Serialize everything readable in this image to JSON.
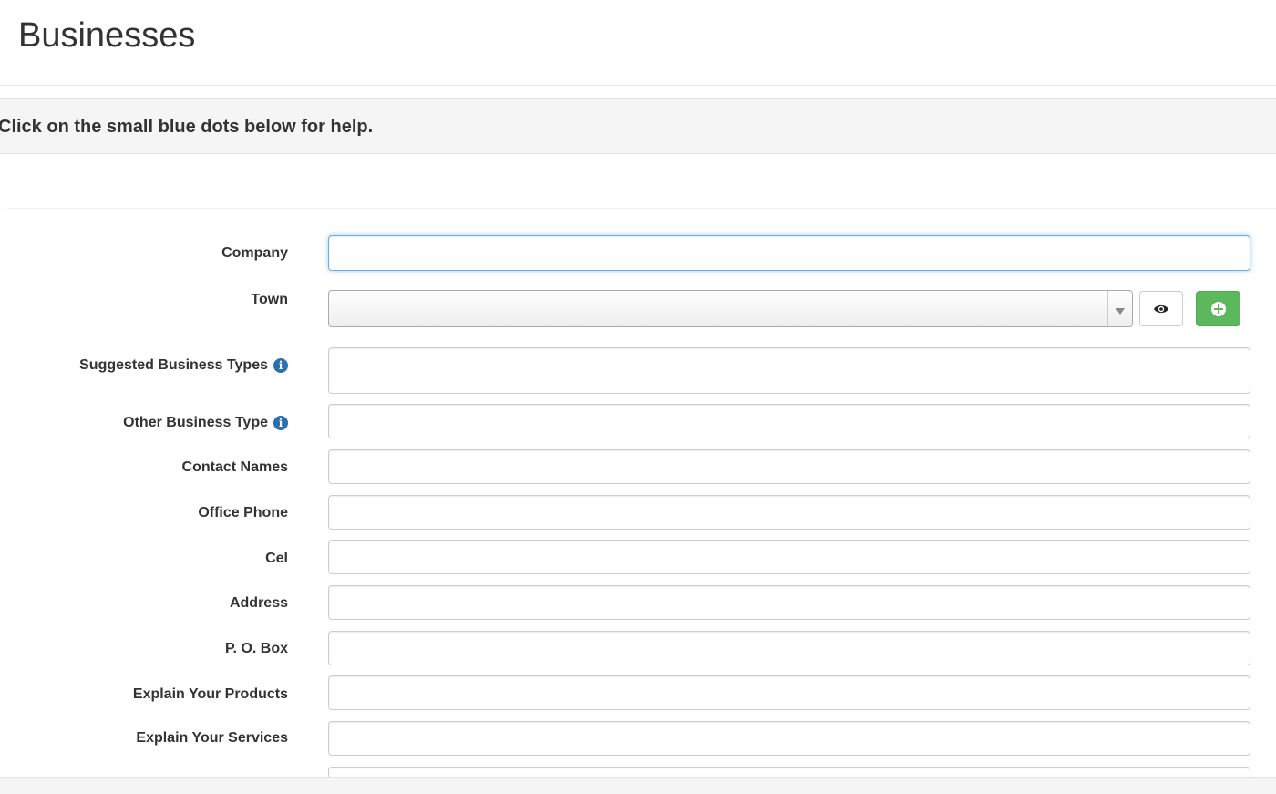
{
  "header": {
    "title": "Businesses"
  },
  "help": {
    "text": "Click on the small blue dots below for help."
  },
  "form": {
    "company": {
      "label": "Company",
      "value": ""
    },
    "town": {
      "label": "Town",
      "selected": ""
    },
    "suggested_business_types": {
      "label": "Suggested Business Types",
      "value": ""
    },
    "other_business_type": {
      "label": "Other Business Type",
      "value": ""
    },
    "contact_names": {
      "label": "Contact Names",
      "value": ""
    },
    "office_phone": {
      "label": "Office Phone",
      "value": ""
    },
    "cel": {
      "label": "Cel",
      "value": ""
    },
    "address": {
      "label": "Address",
      "value": ""
    },
    "po_box": {
      "label": "P. O. Box",
      "value": ""
    },
    "explain_products": {
      "label": "Explain Your Products",
      "value": ""
    },
    "explain_services": {
      "label": "Explain Your Services",
      "value": ""
    }
  },
  "icons": {
    "info": "info-circle-icon",
    "view": "eye-icon",
    "add": "plus-circle-icon"
  },
  "colors": {
    "info_icon": "#2a6fb0",
    "add_button": "#5cb85c",
    "focus_border": "#66afe9"
  }
}
